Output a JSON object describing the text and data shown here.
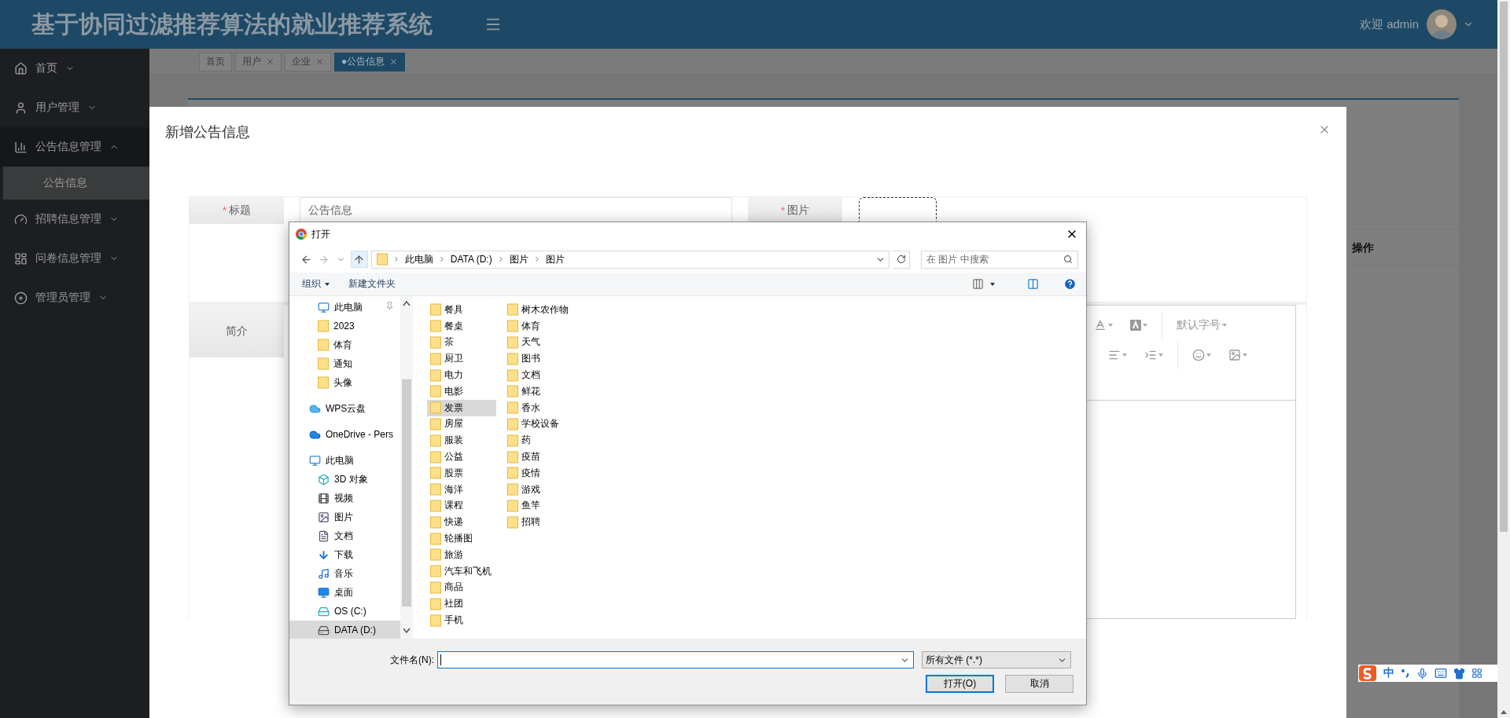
{
  "header": {
    "title": "基于协同过滤推荐算法的就业推荐系统",
    "welcome": "欢迎 admin"
  },
  "sidebar": {
    "items": [
      {
        "label": "首页",
        "expanded": false
      },
      {
        "label": "用户管理",
        "expanded": false
      },
      {
        "label": "公告信息管理",
        "expanded": true,
        "children": [
          {
            "label": "公告信息",
            "selected": true
          }
        ]
      },
      {
        "label": "招聘信息管理",
        "expanded": false
      },
      {
        "label": "问卷信息管理",
        "expanded": false
      },
      {
        "label": "管理员管理",
        "expanded": false
      }
    ]
  },
  "tabs": [
    {
      "label": "首页",
      "selected": false,
      "closable": false
    },
    {
      "label": "用户",
      "selected": false,
      "closable": true
    },
    {
      "label": "企业",
      "selected": false,
      "closable": true
    },
    {
      "label": "●公告信息",
      "selected": true,
      "closable": true
    }
  ],
  "table": {
    "columns": [
      "操作"
    ]
  },
  "modal": {
    "title": "新增公告信息",
    "title_field": {
      "mark": "*",
      "label": "标题",
      "value": "公告信息"
    },
    "image_field": {
      "mark": "*",
      "label": "图片"
    },
    "intro_field": {
      "label": "简介"
    },
    "editor": {
      "font_size": "默认字号"
    }
  },
  "file_dialog": {
    "title": "打开",
    "path": [
      "此电脑",
      "DATA (D:)",
      "图片",
      "图片"
    ],
    "search": {
      "placeholder": "在 图片 中搜索"
    },
    "toolbar": [
      "组织",
      "新建文件夹"
    ],
    "nav": [
      {
        "children": [
          {
            "label": "此电脑",
            "kind": "pc",
            "pinned": true,
            "selected": false
          },
          {
            "label": "2023",
            "kind": "folder",
            "pinned": false,
            "selected": false
          },
          {
            "label": "体育",
            "kind": "folder",
            "pinned": false,
            "selected": false
          },
          {
            "label": "通知",
            "kind": "folder",
            "pinned": false,
            "selected": false
          },
          {
            "label": "头像",
            "kind": "folder",
            "pinned": false,
            "selected": false
          }
        ]
      },
      {
        "label": "WPS云盘",
        "kind": "cloud",
        "selected": false
      },
      {
        "label": "OneDrive - Pers",
        "kind": "onedrive",
        "selected": false
      },
      {
        "label": "此电脑",
        "kind": "pc",
        "selected": false,
        "children": [
          {
            "label": "3D 对象",
            "kind": "objects",
            "selected": false
          },
          {
            "label": "视频",
            "kind": "video",
            "selected": false
          },
          {
            "label": "图片",
            "kind": "pictures",
            "selected": false
          },
          {
            "label": "文档",
            "kind": "documents",
            "selected": false
          },
          {
            "label": "下载",
            "kind": "downloads",
            "selected": false
          },
          {
            "label": "音乐",
            "kind": "music",
            "selected": false
          },
          {
            "label": "桌面",
            "kind": "desktop",
            "selected": false
          },
          {
            "label": "OS (C:)",
            "kind": "system",
            "selected": false
          },
          {
            "label": "DATA (D:)",
            "kind": "drive",
            "selected": true
          }
        ]
      }
    ],
    "files": [
      {
        "label": "餐具",
        "selected": false
      },
      {
        "label": "餐桌",
        "selected": false
      },
      {
        "label": "茶",
        "selected": false
      },
      {
        "label": "厨卫",
        "selected": false
      },
      {
        "label": "电力",
        "selected": false
      },
      {
        "label": "电影",
        "selected": false
      },
      {
        "label": "发票",
        "selected": true
      },
      {
        "label": "房屋",
        "selected": false
      },
      {
        "label": "服装",
        "selected": false
      },
      {
        "label": "公益",
        "selected": false
      },
      {
        "label": "股票",
        "selected": false
      },
      {
        "label": "海洋",
        "selected": false
      },
      {
        "label": "课程",
        "selected": false
      },
      {
        "label": "快递",
        "selected": false
      },
      {
        "label": "轮播图",
        "selected": false
      },
      {
        "label": "旅游",
        "selected": false
      },
      {
        "label": "汽车和飞机",
        "selected": false
      },
      {
        "label": "商品",
        "selected": false
      },
      {
        "label": "社团",
        "selected": false
      },
      {
        "label": "手机",
        "selected": false
      },
      {
        "label": "树木农作物",
        "selected": false
      },
      {
        "label": "体育",
        "selected": false
      },
      {
        "label": "天气",
        "selected": false
      },
      {
        "label": "图书",
        "selected": false
      },
      {
        "label": "文档",
        "selected": false
      },
      {
        "label": "鲜花",
        "selected": false
      },
      {
        "label": "香水",
        "selected": false
      },
      {
        "label": "学校设备",
        "selected": false
      },
      {
        "label": "药",
        "selected": false
      },
      {
        "label": "疫苗",
        "selected": false
      },
      {
        "label": "疫情",
        "selected": false
      },
      {
        "label": "游戏",
        "selected": false
      },
      {
        "label": "鱼竿",
        "selected": false
      },
      {
        "label": "招聘",
        "selected": false
      }
    ],
    "file_name": {
      "label": "文件名(N):"
    },
    "file_type": "所有文件 (*.*)",
    "buttons": [
      "打开(O)",
      "取消"
    ]
  },
  "ime_bar": {
    "mode": "中"
  }
}
